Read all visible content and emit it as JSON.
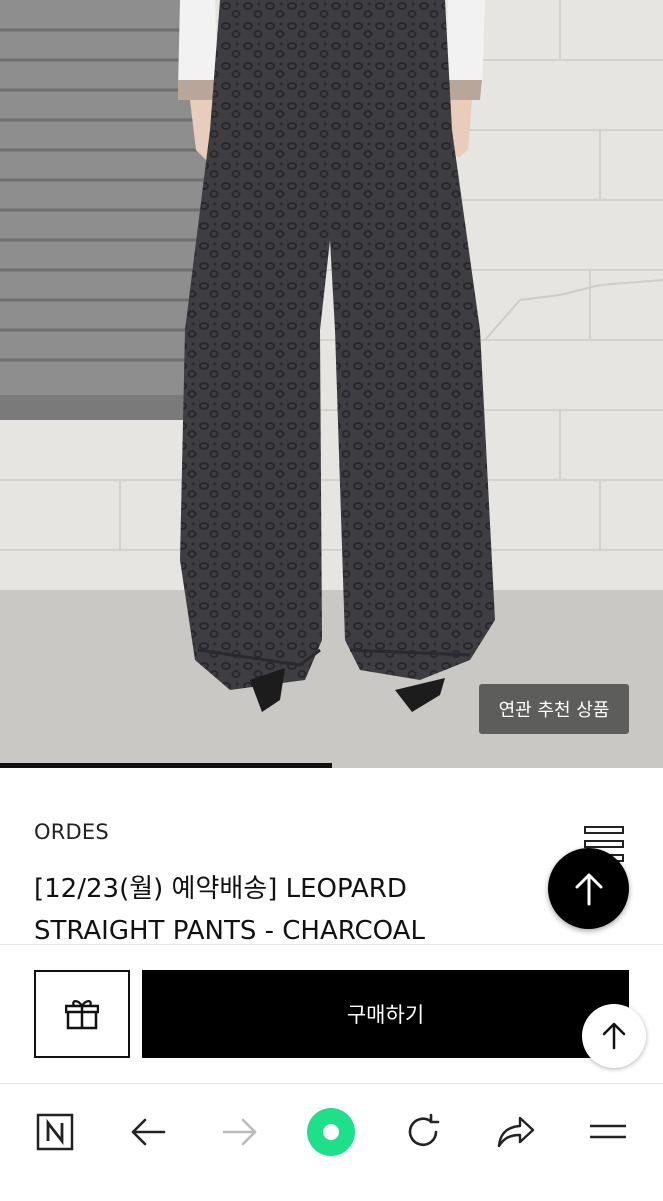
{
  "hero": {
    "related_label": "연관 추천 상품",
    "image_progress": 0.5
  },
  "product": {
    "brand": "ORDES",
    "title_line1": "[12/23(월) 예약배송]  LEOPARD",
    "title_line2": "STRAIGHT PANTS - CHARCOAL"
  },
  "purchase": {
    "buy_label": "구매하기"
  },
  "icons": {
    "gift": "gift-icon",
    "scroll_top": "arrow-up-icon",
    "naver": "naver-n-icon",
    "back": "arrow-left-icon",
    "forward": "arrow-right-icon",
    "home": "green-dot-icon",
    "reload": "reload-icon",
    "share": "share-icon",
    "menu": "menu-icon"
  },
  "colors": {
    "accent_green": "#1ee08a",
    "primary": "#000000"
  }
}
